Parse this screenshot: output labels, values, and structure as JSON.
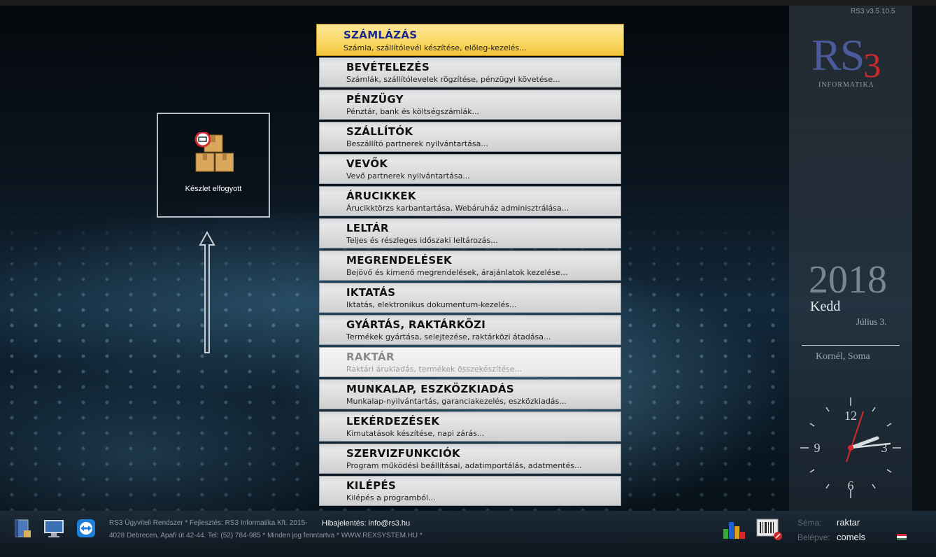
{
  "version": "RS3 v3.5.10.5",
  "logo": {
    "text": "RS",
    "sub_digit": "3",
    "subtitle": "INFORMATIKA"
  },
  "calendar": {
    "year": "2018",
    "day": "Kedd",
    "date": "Július 3.",
    "names": "Kornél, Soma"
  },
  "clock": {
    "hour_12": "12",
    "hour_3": "3",
    "hour_6": "6",
    "hour_9": "9"
  },
  "widget": {
    "label": "Készlet elfogyott",
    "icon": "boxes-empty-icon"
  },
  "menu": [
    {
      "title": "SZÁMLÁZÁS",
      "desc": "Számla, szállítólevél készítése, előleg-kezelés...",
      "state": "active"
    },
    {
      "title": "BEVÉTELEZÉS",
      "desc": "Számlák, szállítólevelek rögzítése, pénzügyi követése...",
      "state": "normal"
    },
    {
      "title": "PÉNZÜGY",
      "desc": "Pénztár, bank és költségszámlák...",
      "state": "normal"
    },
    {
      "title": "SZÁLLÍTÓK",
      "desc": "Beszállító partnerek nyilvántartása...",
      "state": "normal"
    },
    {
      "title": "VEVŐK",
      "desc": "Vevő partnerek nyilvántartása...",
      "state": "normal"
    },
    {
      "title": "ÁRUCIKKEK",
      "desc": "Árucikktörzs karbantartása, Webáruház adminisztrálása...",
      "state": "normal"
    },
    {
      "title": "LELTÁR",
      "desc": "Teljes és részleges időszaki leltározás...",
      "state": "normal"
    },
    {
      "title": "MEGRENDELÉSEK",
      "desc": "Bejövő és kimenő megrendelések, árajánlatok kezelése...",
      "state": "normal"
    },
    {
      "title": "IKTATÁS",
      "desc": "Iktatás, elektronikus dokumentum-kezelés...",
      "state": "normal"
    },
    {
      "title": "GYÁRTÁS, RAKTÁRKÖZI",
      "desc": "Termékek gyártása, selejtezése, raktárközi átadása...",
      "state": "normal"
    },
    {
      "title": "RAKTÁR",
      "desc": "Raktári árukiadás, termékek összekészítése...",
      "state": "disabled"
    },
    {
      "title": "MUNKALAP, ESZKÖZKIADÁS",
      "desc": "Munkalap-nyilvántartás, garanciakezelés, eszközkiadás...",
      "state": "normal"
    },
    {
      "title": "LEKÉRDEZÉSEK",
      "desc": "Kimutatások készítése, napi zárás...",
      "state": "normal"
    },
    {
      "title": "SZERVIZFUNKCIÓK",
      "desc": "Program működési beállításai, adatimportálás, adatmentés...",
      "state": "normal"
    },
    {
      "title": "KILÉPÉS",
      "desc": "Kilépés a programból...",
      "state": "normal"
    }
  ],
  "footer": {
    "line1": "RS3 Ügyviteli Rendszer * Fejlesztés: RS3 Informatika Kft. 2015-",
    "line2": "4028 Debrecen, Apafi út 42-44. Tel: (52) 784-985 * Minden jog fenntartva * WWW.REXSYSTEM.HU *",
    "bug_report": "Hibajelentés: info@rs3.hu",
    "icons": [
      "notebook-icon",
      "monitor-icon",
      "teamviewer-icon",
      "bar-chart-icon",
      "barcode-icon"
    ]
  },
  "session": {
    "schema_label": "Séma:",
    "schema_value": "raktar",
    "login_label": "Belépve:",
    "login_value": "comels"
  },
  "colors": {
    "active_item": "#f9d865",
    "active_title": "#1a2a8a",
    "panel": "#3c4650"
  }
}
